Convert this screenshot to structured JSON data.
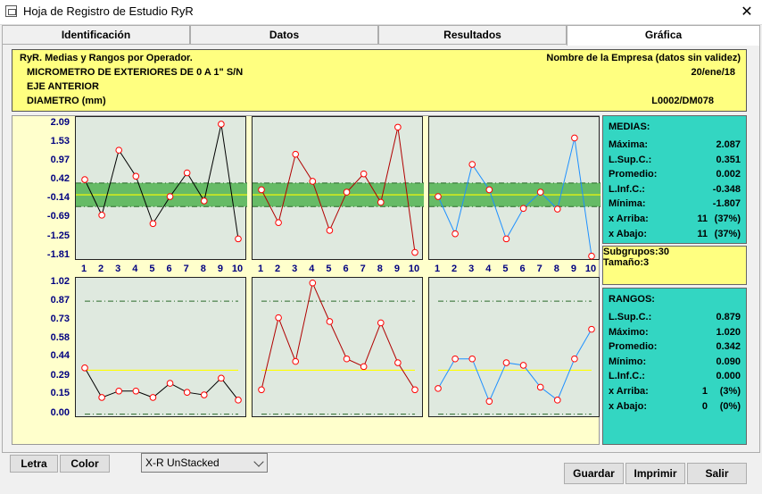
{
  "window": {
    "title": "Hoja de Registro de Estudio RyR",
    "close_glyph": "✕"
  },
  "tabs": [
    "Identificación",
    "Datos",
    "Resultados",
    "Gráfica"
  ],
  "active_tab": 3,
  "header": {
    "left1": "RyR. Medias y Rangos por Operador.",
    "right1": "Nombre de la Empresa (datos sin validez)",
    "left2": "MICROMETRO DE EXTERIORES DE 0 A 1\" S/N",
    "right2": "20/ene/18",
    "left3": "EJE ANTERIOR",
    "left4": "DIAMETRO (mm)",
    "right4": "L0002/DM078"
  },
  "colors": {
    "series1": "#000000",
    "series2": "#b00000",
    "series3": "#1e90ff",
    "limits_band": "#66bb66",
    "center_line": "#ffff00",
    "dashdot": "#2a6a2a",
    "marker_fill": "#ffffff",
    "marker_stroke": "#ff0000"
  },
  "chart_data": [
    {
      "type": "line",
      "title": "Medias",
      "x": [
        1,
        2,
        3,
        4,
        5,
        6,
        7,
        8,
        9,
        10
      ],
      "yticks": [
        "2.09",
        "1.53",
        "0.97",
        "0.42",
        "-0.14",
        "-0.69",
        "-1.25",
        "-1.81"
      ],
      "ylim": [
        -1.95,
        2.3
      ],
      "limits": {
        "upper": 0.351,
        "center": 0.002,
        "lower": -0.348
      },
      "series": [
        {
          "values": [
            0.45,
            -0.6,
            1.32,
            0.55,
            -0.85,
            -0.05,
            0.65,
            -0.18,
            2.09,
            -1.3
          ]
        },
        {
          "values": [
            0.15,
            -0.82,
            1.2,
            0.4,
            -1.05,
            0.08,
            0.62,
            -0.22,
            2.0,
            -1.7
          ]
        },
        {
          "values": [
            -0.05,
            -1.15,
            0.9,
            0.15,
            -1.3,
            -0.4,
            0.08,
            -0.42,
            1.68,
            -1.81
          ]
        }
      ]
    },
    {
      "type": "line",
      "title": "Rangos",
      "x": [
        1,
        2,
        3,
        4,
        5,
        6,
        7,
        8,
        9,
        10
      ],
      "yticks": [
        "1.02",
        "0.87",
        "0.73",
        "0.58",
        "0.44",
        "0.29",
        "0.15",
        "0.00"
      ],
      "ylim": [
        -0.03,
        1.06
      ],
      "limits": {
        "upper": 0.879,
        "center": 0.342,
        "lower": 0.0
      },
      "series": [
        {
          "values": [
            0.36,
            0.13,
            0.18,
            0.18,
            0.13,
            0.24,
            0.17,
            0.15,
            0.28,
            0.11
          ]
        },
        {
          "values": [
            0.19,
            0.75,
            0.41,
            1.02,
            0.72,
            0.43,
            0.37,
            0.71,
            0.4,
            0.19
          ]
        },
        {
          "values": [
            0.2,
            0.43,
            0.43,
            0.1,
            0.4,
            0.38,
            0.21,
            0.11,
            0.43,
            0.66
          ]
        }
      ]
    }
  ],
  "medias": {
    "title": "MEDIAS:",
    "rows": [
      {
        "label": "Máxima:",
        "value": "2.087"
      },
      {
        "label": "L.Sup.C.:",
        "value": "0.351"
      },
      {
        "label": "Promedio:",
        "value": "0.002"
      },
      {
        "label": "L.Inf.C.:",
        "value": "-0.348"
      },
      {
        "label": "Mínima:",
        "value": "-1.807"
      },
      {
        "label": "x Arriba:",
        "value": "11",
        "pct": "(37%)"
      },
      {
        "label": "x Abajo:",
        "value": "11",
        "pct": "(37%)"
      }
    ]
  },
  "subgroups": {
    "rows": [
      {
        "label": "Subgrupos:",
        "value": "30"
      },
      {
        "label": "Tamaño:",
        "value": "3"
      }
    ]
  },
  "rangos": {
    "title": "RANGOS:",
    "rows": [
      {
        "label": "L.Sup.C.:",
        "value": "0.879"
      },
      {
        "label": "Máximo:",
        "value": "1.020"
      },
      {
        "label": "Promedio:",
        "value": "0.342"
      },
      {
        "label": "Mínimo:",
        "value": "0.090"
      },
      {
        "label": "L.Inf.C.:",
        "value": "0.000"
      },
      {
        "label": "x Arriba:",
        "value": "1",
        "pct": "(3%)"
      },
      {
        "label": "x Abajo:",
        "value": "0",
        "pct": "(0%)"
      }
    ]
  },
  "controls": {
    "letra": "Letra",
    "color": "Color",
    "chart_type": "X-R UnStacked",
    "guardar": "Guardar",
    "imprimir": "Imprimir",
    "salir": "Salir"
  }
}
